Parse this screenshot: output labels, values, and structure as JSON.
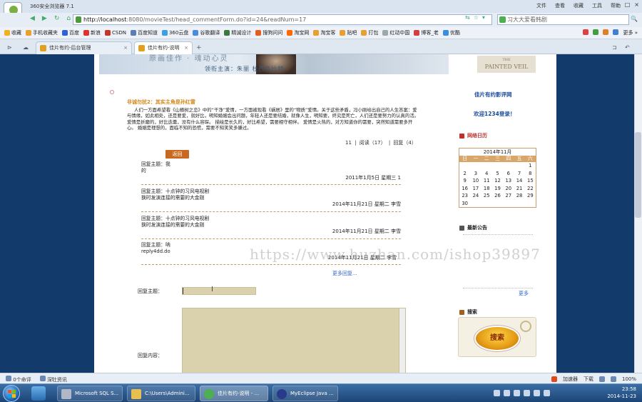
{
  "browser": {
    "title": "360安全浏览器 7.1",
    "menu": [
      "文件",
      "查看",
      "收藏",
      "工具",
      "帮助"
    ],
    "window_controls": [
      "−",
      "□",
      "×"
    ],
    "nav": [
      "◀",
      "▶",
      "↻",
      "⌂"
    ],
    "url_host": "http://localhost",
    "url_rest": ":8080/movieTest/head_commentForm.do?id=24&readNum=17",
    "search_placeholder": "习大大爱看韩剧",
    "search_icon": "🔍",
    "bookmarks": [
      "收藏",
      "手机收藏夹",
      "百度",
      "新浪",
      "CSDN",
      "百度知道",
      "360云盘",
      "谷歌翻译",
      "精诚设计",
      "搜狗问问",
      "淘宝网",
      "淘宝客",
      "贴吧",
      "打包",
      "红动中国",
      "博客_老",
      "优酷"
    ],
    "bookmarks_more": "更多 »",
    "tabs": [
      {
        "label": "佳片有约-后台管理"
      },
      {
        "label": "佳片有约-说明"
      }
    ]
  },
  "page": {
    "banner_top": "原画佳作 · 魂动心灵",
    "banner_text": "领衔主演：朱丽 杜西多比特",
    "painted_small": "THE",
    "painted_big": "PAINTED VEIL",
    "article": {
      "title": "非诚勿扰2：其实主角是孙红雷",
      "body": "人们一方面希望看《山楂树之恋》中的“干净”爱情，一方面被现看《蜗居》里的“物质”爱情。关于这些矛盾，冯小刚给出自己的人生答案：爱与情缘，如此相处，还是要爱，就好比，明知婚姻会出问题，年轻人还是要结婚，就像人生，明知要，终究是死亡，人们还是要努力的认真的活。   爱情是折磨的，好比迭羹，没有什么容琛。   描绘是长久的，好比希望，需要相守相伴。   爱情是火热的，对方知道你的需要，突然知道需要多开心。   婚姻是理想的，面临不知的恐慌，需要不知笑笑多嫌过。",
      "stats": "11 | 阅读（17） | 回复（4）"
    },
    "back_button": "返回",
    "replies": [
      {
        "body": "回复主题：我\n的",
        "meta": "2011年1月5日 星期三    1"
      },
      {
        "body": "回复主题：十点钟的习风电视剧\n换时发演连接的需要的大金刚",
        "meta": "2014年11月21日 星期二    李雪"
      },
      {
        "body": "回复主题：十点钟的习风电视剧\n换时发演连接的需要的大金刚",
        "meta": "2014年11月21日 星期二    李雪"
      },
      {
        "body": "回复主题：呐\nreply4dd.do",
        "meta": "2014年11月21日 星期二    李雪"
      }
    ],
    "more_replies": "更多回复...",
    "form": {
      "subject_label": "回复主题：",
      "content_label": "回复内容："
    },
    "sidebar": {
      "site_title": "佳片有约影评网",
      "welcome": "欢迎1234登录！",
      "calendar_heading": "网络日历",
      "calendar_caption": "2014年11月",
      "weekdays": [
        "日",
        "一",
        "二",
        "三",
        "四",
        "五",
        "六"
      ],
      "weeks": [
        [
          "",
          "",
          "",
          "",
          "",
          "",
          "1"
        ],
        [
          "2",
          "3",
          "4",
          "5",
          "6",
          "7",
          "8"
        ],
        [
          "9",
          "10",
          "11",
          "12",
          "13",
          "14",
          "15"
        ],
        [
          "16",
          "17",
          "18",
          "19",
          "20",
          "21",
          "22"
        ],
        [
          "23",
          "24",
          "25",
          "26",
          "27",
          "28",
          "29"
        ],
        [
          "30",
          "",
          "",
          "",
          "",
          "",
          ""
        ]
      ],
      "notice_heading": "最新公告",
      "notice_more": "更多",
      "search_heading": "搜索",
      "search_button": "搜索"
    },
    "watermark": "https://www.huzhan.com/ishop39897"
  },
  "statusbar": {
    "left": [
      "0个命评",
      "深牡资讯"
    ],
    "right": [
      "加速器",
      "下载",
      "100%"
    ]
  },
  "taskbar": {
    "items": [
      {
        "label": "Microsoft SQL S..."
      },
      {
        "label": "C:\\Users\\Admini..."
      },
      {
        "label": "佳片有约-说明 - ..."
      },
      {
        "label": "MyEclipse Java ..."
      }
    ],
    "time": "23:58",
    "date": "2014-11-23"
  }
}
